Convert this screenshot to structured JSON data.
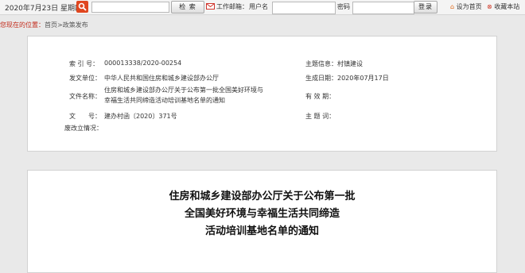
{
  "topbar": {
    "date_text": "2020年7月23日 星期四",
    "search_placeholder": "",
    "search_button": "检 索",
    "email_label": "工作邮箱：",
    "username_label": "用户名",
    "password_label": "密码",
    "login_button": "登录",
    "set_home": "设为首页",
    "add_favorite": "收藏本站"
  },
  "breadcrumb": {
    "prefix": "您现在的位置：",
    "home": "首页",
    "separator": ">",
    "current": "政策发布"
  },
  "info": {
    "index_label": "索 引 号：",
    "index_value": "000013338/2020-00254",
    "topic_label": "主题信息：",
    "topic_value": "村镇建设",
    "issuer_label": "发文单位：",
    "issuer_value": "中华人民共和国住房和城乡建设部办公厅",
    "date_label": "生成日期：",
    "date_value": "2020年07月17日",
    "name_label": "文件名称：",
    "name_line1": "住房和城乡建设部办公厅关于公布第一批全国美好环境与",
    "name_line2": "幸福生活共同缔造活动培训基地名单的通知",
    "validity_label": "有 效 期：",
    "validity_value": "",
    "docno_label": "文　　号：",
    "docno_value": "建办村函〔2020〕371号",
    "keywords_label": "主 题 词：",
    "keywords_value": "",
    "revision_label": "废改立情况：",
    "revision_value": ""
  },
  "document": {
    "title_line1": "住房和城乡建设部办公厅关于公布第一批",
    "title_line2": "全国美好环境与幸福生活共同缔造",
    "title_line3": "活动培训基地名单的通知"
  }
}
